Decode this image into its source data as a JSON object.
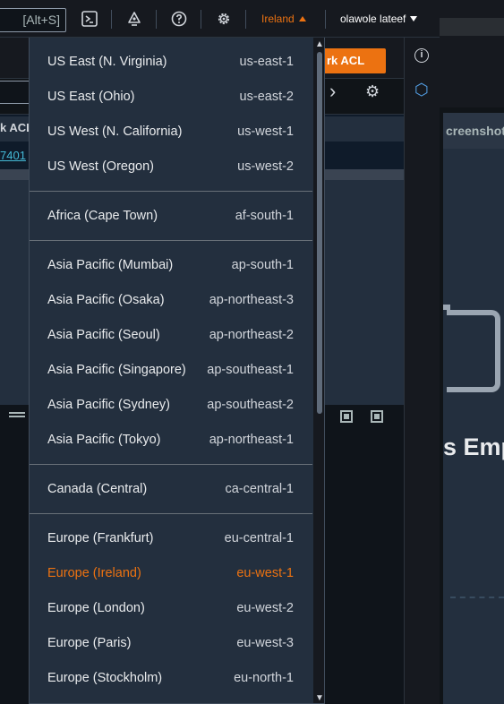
{
  "topnav": {
    "search_shortcut": "[Alt+S]",
    "region_label": "Ireland",
    "user_label": "olawole lateef"
  },
  "background": {
    "action_button_fragment": "rk ACL",
    "section_header_fragment": "k ACL",
    "link_fragment": "7401",
    "right_panel_header": "creenshot",
    "right_panel_text": "s Emp"
  },
  "regions": {
    "groups": [
      {
        "items": [
          {
            "name": "US East (N. Virginia)",
            "code": "us-east-1"
          },
          {
            "name": "US East (Ohio)",
            "code": "us-east-2"
          },
          {
            "name": "US West (N. California)",
            "code": "us-west-1"
          },
          {
            "name": "US West (Oregon)",
            "code": "us-west-2"
          }
        ]
      },
      {
        "items": [
          {
            "name": "Africa (Cape Town)",
            "code": "af-south-1"
          }
        ]
      },
      {
        "items": [
          {
            "name": "Asia Pacific (Mumbai)",
            "code": "ap-south-1"
          },
          {
            "name": "Asia Pacific (Osaka)",
            "code": "ap-northeast-3"
          },
          {
            "name": "Asia Pacific (Seoul)",
            "code": "ap-northeast-2"
          },
          {
            "name": "Asia Pacific (Singapore)",
            "code": "ap-southeast-1"
          },
          {
            "name": "Asia Pacific (Sydney)",
            "code": "ap-southeast-2"
          },
          {
            "name": "Asia Pacific (Tokyo)",
            "code": "ap-northeast-1"
          }
        ]
      },
      {
        "items": [
          {
            "name": "Canada (Central)",
            "code": "ca-central-1"
          }
        ]
      },
      {
        "items": [
          {
            "name": "Europe (Frankfurt)",
            "code": "eu-central-1"
          },
          {
            "name": "Europe (Ireland)",
            "code": "eu-west-1",
            "selected": true
          },
          {
            "name": "Europe (London)",
            "code": "eu-west-2"
          },
          {
            "name": "Europe (Paris)",
            "code": "eu-west-3"
          },
          {
            "name": "Europe (Stockholm)",
            "code": "eu-north-1"
          }
        ]
      }
    ]
  },
  "colors": {
    "accent": "#ec7211",
    "menu_bg": "#232f3e",
    "nav_bg": "#16191f",
    "text": "#e9ebed"
  }
}
